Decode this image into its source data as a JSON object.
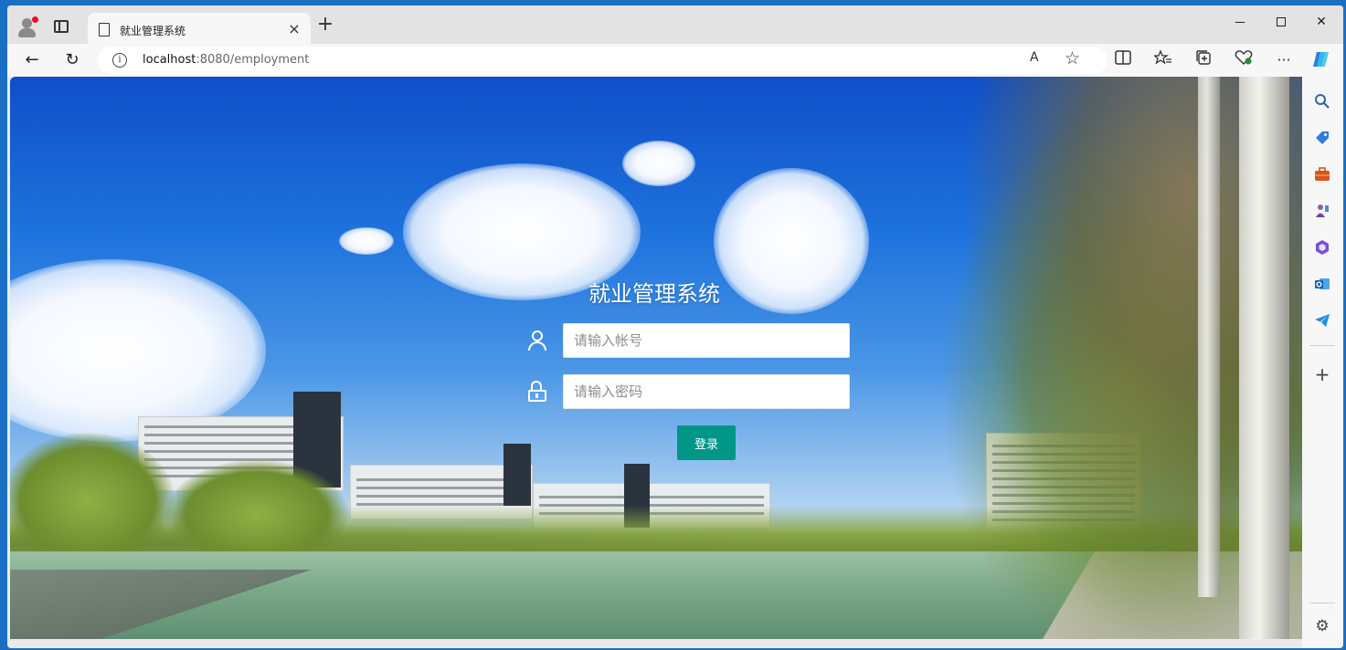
{
  "browser": {
    "tab": {
      "title": "就业管理系统",
      "close": "×"
    },
    "new_tab": "+",
    "window_controls": {
      "close": "✕"
    },
    "nav": {
      "back": "←",
      "reload": "↻"
    },
    "address": {
      "host": "localhost",
      "path": ":8080/employment",
      "info": "i"
    },
    "read_aloud": "A",
    "favorite": "☆",
    "toolbar_icons": [
      "split-screen-icon",
      "favorites-icon",
      "collections-icon",
      "browser-essentials-icon",
      "more-icon",
      "copilot-icon"
    ],
    "more": "···"
  },
  "sidebar": {
    "items": [
      "search-icon",
      "shopping-tag-icon",
      "tools-briefcase-icon",
      "games-icon",
      "office-icon",
      "outlook-icon",
      "telegram-icon"
    ],
    "add": "+",
    "settings": "⚙"
  },
  "login": {
    "title": "就业管理系统",
    "username_placeholder": "请输入帐号",
    "username_value": "",
    "password_placeholder": "请输入密码",
    "password_value": "",
    "submit_label": "登录",
    "button_color": "#009688"
  }
}
